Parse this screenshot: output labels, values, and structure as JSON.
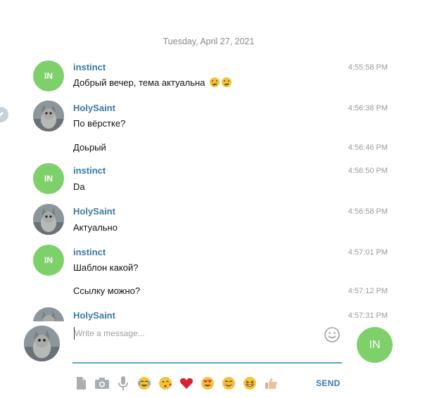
{
  "date_header": "Tuesday, April 27, 2021",
  "messages": [
    {
      "author": "instinct",
      "avatar_initials": "IN",
      "time": "4:55:58 PM",
      "text": "Добрый вечер, тема актуальна",
      "emoji": [
        "thinking-face",
        "thinking-face"
      ]
    },
    {
      "author": "HolySaint",
      "time": "4:56:38 PM",
      "text": "По вёрстке?"
    },
    {
      "time": "4:56:46 PM",
      "text": "Доьрый"
    },
    {
      "author": "instinct",
      "avatar_initials": "IN",
      "time": "4:56:50 PM",
      "text": "Da"
    },
    {
      "author": "HolySaint",
      "time": "4:56:58 PM",
      "text": "Актуально"
    },
    {
      "author": "instinct",
      "avatar_initials": "IN",
      "time": "4:57:01 PM",
      "text": "Шаблон какой?"
    },
    {
      "time": "4:57:12 PM",
      "text": "Ссылку можно?"
    },
    {
      "author": "HolySaint",
      "time": "4:57:31 PM",
      "text": ""
    }
  ],
  "composer": {
    "placeholder": "Write a message...",
    "value": "",
    "self_avatar_initials": "IN",
    "send_label": "SEND",
    "quick_reactions": [
      "face-with-tears-of-joy",
      "face-blowing-kiss",
      "red-heart",
      "smiling-face-with-heart-eyes",
      "smiling-face",
      "grinning-squinting-face",
      "thumbs-up"
    ],
    "tools": [
      "attach-file-icon",
      "camera-icon",
      "microphone-icon"
    ]
  },
  "colors": {
    "accent": "#3a78a8",
    "avatar_green": "#7ed06a",
    "input_underline": "#5ba3c7",
    "muted_text": "#9a9a9a"
  }
}
